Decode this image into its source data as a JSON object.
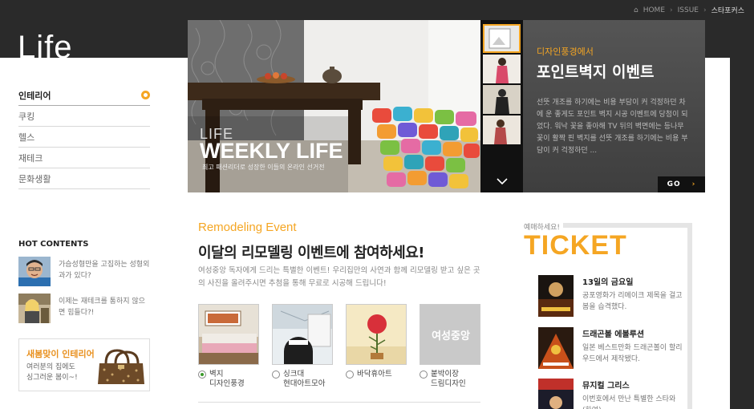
{
  "breadcrumb": {
    "home": "HOME",
    "issue": "ISSUE",
    "current": "스타포커스"
  },
  "logo": "Life",
  "nav": [
    {
      "label": "인테리어",
      "active": true
    },
    {
      "label": "쿠킹"
    },
    {
      "label": "헬스"
    },
    {
      "label": "재테크"
    },
    {
      "label": "문화생활"
    }
  ],
  "hot": {
    "title": "HOT CONTENTS",
    "items": [
      {
        "text": "가슴성형만을 고집하는 성형외과가 있다?"
      },
      {
        "text": "이제는 재테크를 통하지 않으면 힘들다?!"
      }
    ]
  },
  "banner": {
    "title": "새봄맞이 인테리어",
    "desc": "여러분의 집에도 싱그러운 봄이~!"
  },
  "hero": {
    "kicker": "LIFE",
    "title": "WEEKLY LIFE",
    "caption": "최고 패션리더로 성장한 이들의 온라인 선거전",
    "panel_sub": "디자인풍경에서",
    "panel_title": "포인트벽지 이벤트",
    "panel_body": "선뜻 개조를 하기에는 비용 부담이 커 걱정하던 차에 운 좋게도 포인트 벽지 시공 이벤트에 당첨이 되었다. 워낙 꽃을 좋아해 TV 뒤의 벽면에는 등나무 꽃이 활짝 핀 벽지를 선뜻 개조를 하기에는 비용 부담이 커 걱정하던 ...",
    "go_label": "GO"
  },
  "event": {
    "en_title": "Remodeling Event",
    "title": "이달의 리모델링 이벤트에 참여하세요!",
    "desc": "여성중앙 독자에게 드리는 특별한 이벤트! 우리집만의 사연과 함께 리모델링 받고 싶은 곳의 사진을 올려주시면 추첨을 통해 무료로 시공해 드립니다!",
    "options": [
      {
        "line1": "벽지",
        "line2": "디자인풍경",
        "selected": true
      },
      {
        "line1": "싱크대",
        "line2": "현대아트모아"
      },
      {
        "line1": "바닥휴아트",
        "line2": ""
      },
      {
        "line1": "붙박이장",
        "line2": "드림디자인"
      }
    ],
    "placeholder_logo": "여성중앙"
  },
  "ticket": {
    "small": "예매하세요!",
    "big": "TICKET",
    "items": [
      {
        "title": "13일의 금요일",
        "desc": "공포영화가 리메이크 제목을 걸고 봄을 습격했다."
      },
      {
        "title": "드래곤볼 에볼루션",
        "desc": "일본 베스트만화 드래곤볼이 할리우드에서 제작됐다."
      },
      {
        "title": "뮤지컬 그리스",
        "desc": "이번호에서 만난 특별한 스타와(하여)"
      }
    ]
  },
  "colors": {
    "accent": "#f5a623",
    "dark": "#2a2a2a"
  }
}
